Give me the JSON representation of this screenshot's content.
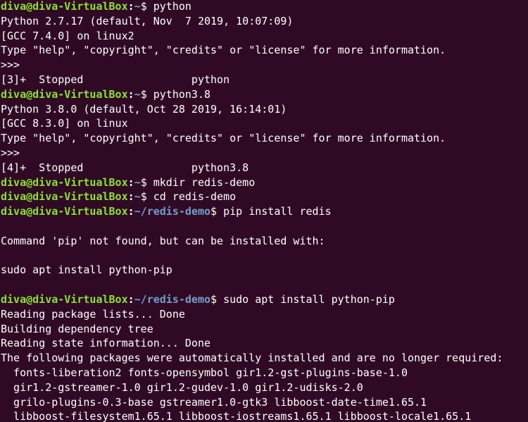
{
  "terminal": {
    "lines": [
      {
        "type": "prompt",
        "user": "diva@diva-VirtualBox",
        "path": "~",
        "cmd": "python"
      },
      {
        "type": "output",
        "text": "Python 2.7.17 (default, Nov  7 2019, 10:07:09)"
      },
      {
        "type": "output",
        "text": "[GCC 7.4.0] on linux2"
      },
      {
        "type": "output",
        "text": "Type \"help\", \"copyright\", \"credits\" or \"license\" for more information."
      },
      {
        "type": "output",
        "text": ">>>"
      },
      {
        "type": "output",
        "text": "[3]+  Stopped                 python"
      },
      {
        "type": "prompt",
        "user": "diva@diva-VirtualBox",
        "path": "~",
        "cmd": "python3.8"
      },
      {
        "type": "output",
        "text": "Python 3.8.0 (default, Oct 28 2019, 16:14:01)"
      },
      {
        "type": "output",
        "text": "[GCC 8.3.0] on linux"
      },
      {
        "type": "output",
        "text": "Type \"help\", \"copyright\", \"credits\" or \"license\" for more information."
      },
      {
        "type": "output",
        "text": ">>>"
      },
      {
        "type": "output",
        "text": "[4]+  Stopped                 python3.8"
      },
      {
        "type": "prompt",
        "user": "diva@diva-VirtualBox",
        "path": "~",
        "cmd": "mkdir redis-demo"
      },
      {
        "type": "prompt",
        "user": "diva@diva-VirtualBox",
        "path": "~",
        "cmd": "cd redis-demo"
      },
      {
        "type": "prompt",
        "user": "diva@diva-VirtualBox",
        "path": "~/redis-demo",
        "cmd": "pip install redis"
      },
      {
        "type": "output",
        "text": ""
      },
      {
        "type": "output",
        "text": "Command 'pip' not found, but can be installed with:"
      },
      {
        "type": "output",
        "text": ""
      },
      {
        "type": "output",
        "text": "sudo apt install python-pip"
      },
      {
        "type": "output",
        "text": ""
      },
      {
        "type": "prompt",
        "user": "diva@diva-VirtualBox",
        "path": "~/redis-demo",
        "cmd": "sudo apt install python-pip"
      },
      {
        "type": "output",
        "text": "Reading package lists... Done"
      },
      {
        "type": "output",
        "text": "Building dependency tree"
      },
      {
        "type": "output",
        "text": "Reading state information... Done"
      },
      {
        "type": "output",
        "text": "The following packages were automatically installed and are no longer required:"
      },
      {
        "type": "output",
        "text": "  fonts-liberation2 fonts-opensymbol gir1.2-gst-plugins-base-1.0"
      },
      {
        "type": "output",
        "text": "  gir1.2-gstreamer-1.0 gir1.2-gudev-1.0 gir1.2-udisks-2.0"
      },
      {
        "type": "output",
        "text": "  grilo-plugins-0.3-base gstreamer1.0-gtk3 libboost-date-time1.65.1"
      },
      {
        "type": "output",
        "text": "  libboost-filesystem1.65.1 libboost-iostreams1.65.1 libboost-locale1.65.1"
      }
    ]
  }
}
